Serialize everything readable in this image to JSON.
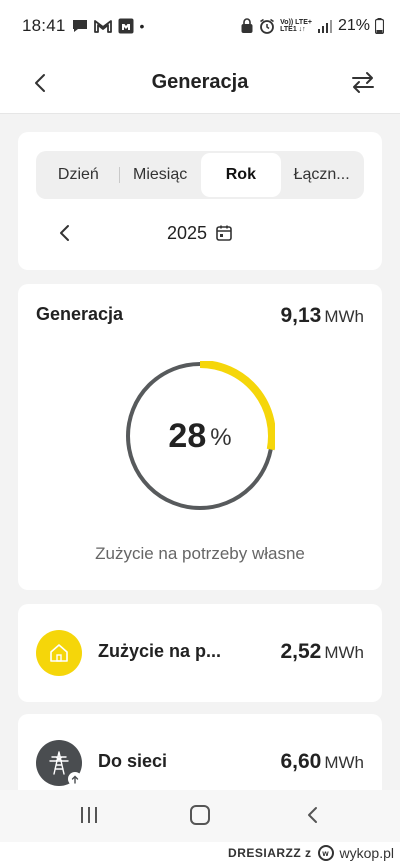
{
  "status_bar": {
    "time": "18:41",
    "dot": "•",
    "net_top": "Vo)) LTE+",
    "net_bottom": "LTE1 ↓↑",
    "battery": "21%",
    "icons": [
      "message-icon",
      "gmail-icon",
      "app-m-icon",
      "alarm-icon",
      "lte-icon",
      "signal-icon",
      "battery-icon"
    ]
  },
  "header": {
    "title": "Generacja",
    "back_icon": "chevron-left-icon",
    "swap_icon": "swap-arrows-icon"
  },
  "period": {
    "tabs": [
      {
        "label": "Dzień"
      },
      {
        "label": "Miesiąc"
      },
      {
        "label": "Rok"
      },
      {
        "label": "Łączn..."
      }
    ],
    "active_tab": "Rok",
    "year": "2025"
  },
  "generation": {
    "title": "Generacja",
    "value": "9,13",
    "unit": "MWh",
    "percent": "28",
    "percent_sign": "%",
    "self_fraction": 0.28,
    "caption": "Zużycie na potrzeby własne"
  },
  "rows": [
    {
      "label": "Zużycie na p...",
      "value": "2,52",
      "unit": "MWh",
      "icon": "home-icon"
    },
    {
      "label": "Do sieci",
      "value": "6,60",
      "unit": "MWh",
      "icon": "power-pylon-icon"
    }
  ],
  "watermark": {
    "author": "DRESIARZZ z",
    "site": "wykop.pl"
  },
  "colors": {
    "accent": "#f5d60a",
    "ring_gray": "#575a5c",
    "grid_icon_bg": "#4a4d50"
  }
}
